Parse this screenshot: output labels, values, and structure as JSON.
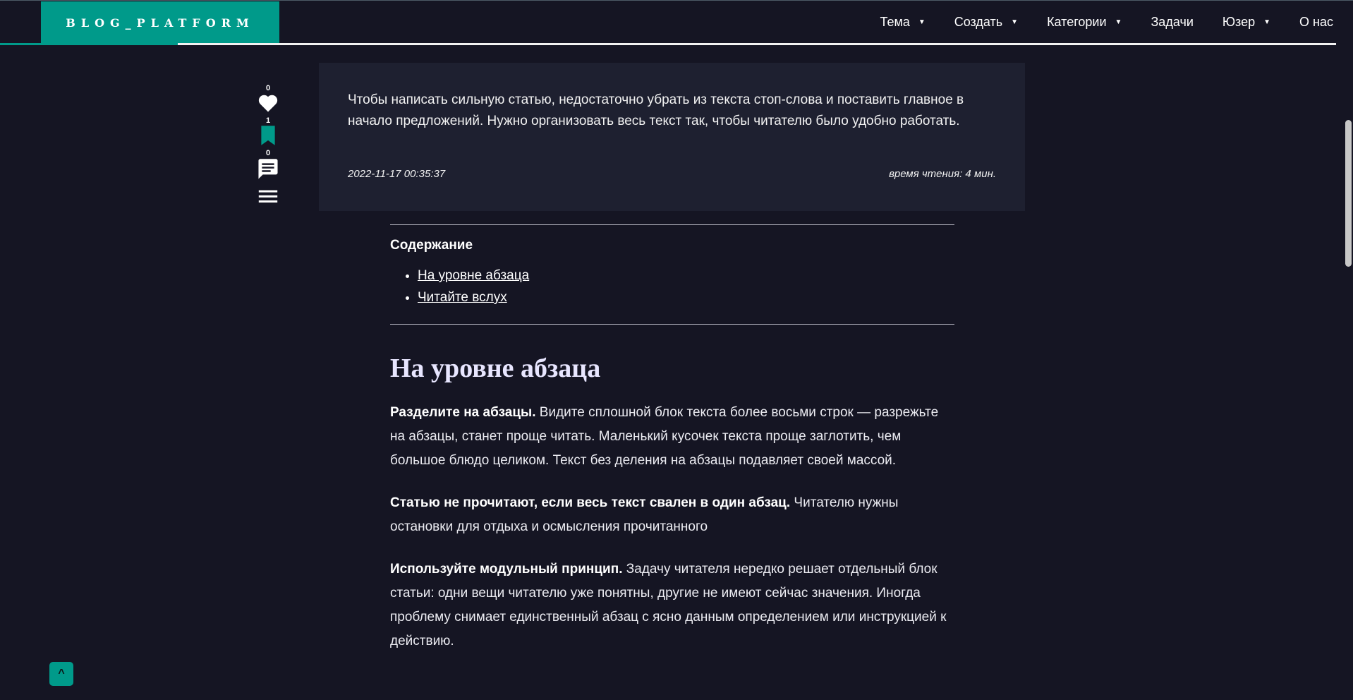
{
  "header": {
    "brand": "BLOG_PLATFORM",
    "nav": [
      {
        "label": "Тема",
        "dropdown": true
      },
      {
        "label": "Создать",
        "dropdown": true
      },
      {
        "label": "Категории",
        "dropdown": true
      },
      {
        "label": "Задачи",
        "dropdown": false
      },
      {
        "label": "Юзер",
        "dropdown": true
      },
      {
        "label": "О нас",
        "dropdown": false
      }
    ]
  },
  "side_actions": {
    "likes": "0",
    "bookmarks": "1",
    "comments": "0"
  },
  "summary": {
    "text": "Чтобы написать сильную статью, недостаточно убрать из текста стоп-слова и поставить главное в начало предложений. Нужно организовать весь текст так, чтобы читателю было удобно работать.",
    "date": "2022-11-17 00:35:37",
    "reading_time": "время чтения: 4 мин."
  },
  "toc": {
    "title": "Содержание",
    "items": [
      "На уровне абзаца",
      "Читайте вслух"
    ]
  },
  "section": {
    "heading": "На уровне абзаца",
    "paragraphs": [
      {
        "bold": "Разделите на абзацы.",
        "text": " Видите сплошной блок текста более восьми строк — разрежьте на абзацы, станет проще читать. Маленький кусочек текста проще заглотить, чем большое блюдо целиком. Текст без деления на абзацы подавляет своей массой."
      },
      {
        "bold": "Статью не прочитают, если весь текст свален в один абзац.",
        "text": " Читателю нужны остановки для отдыха и осмысления прочитанного"
      },
      {
        "bold": "Используйте модульный принцип.",
        "text": " Задачу читателя нередко решает отдельный блок статьи: одни вещи читателю уже понятны, другие не имеют сейчас значения. Иногда проблему снимает единственный абзац с ясно данным определением или инструкцией к действию."
      }
    ]
  },
  "to_top": "^",
  "colors": {
    "accent": "#009a8a",
    "background": "#151523",
    "card": "#1e2030"
  },
  "icons": [
    "heart-icon",
    "bookmark-icon",
    "comment-icon",
    "menu-icon"
  ]
}
